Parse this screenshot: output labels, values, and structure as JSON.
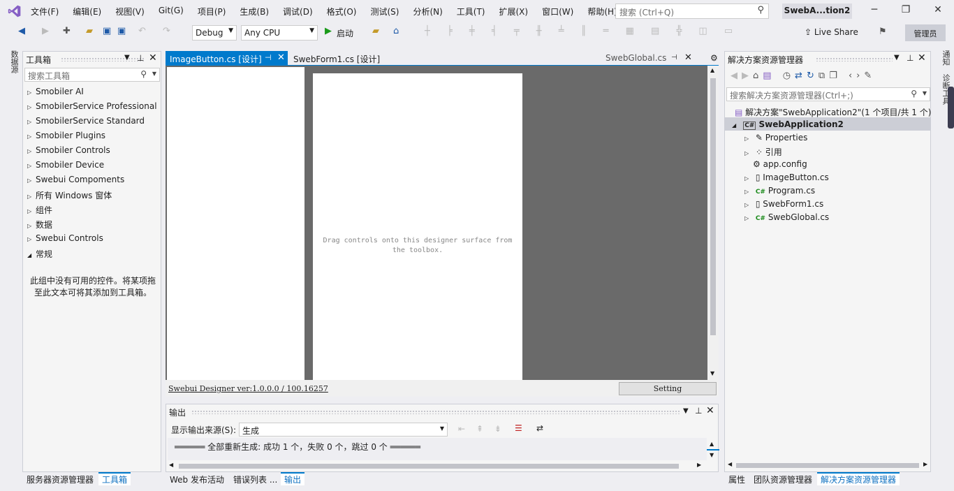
{
  "menu": [
    "文件(F)",
    "编辑(E)",
    "视图(V)",
    "Git(G)",
    "项目(P)",
    "生成(B)",
    "调试(D)",
    "格式(O)",
    "测试(S)",
    "分析(N)",
    "工具(T)",
    "扩展(X)",
    "窗口(W)",
    "帮助(H)"
  ],
  "search": {
    "placeholder": "搜索 (Ctrl+Q)"
  },
  "window": {
    "title": "SwebA...tion2"
  },
  "toolbar": {
    "config": "Debug",
    "platform": "Any CPU",
    "start": "启动",
    "live_share": "Live Share",
    "admin": "管理员"
  },
  "left_strip": "数据源",
  "toolbox": {
    "title": "工具箱",
    "search_placeholder": "搜索工具箱",
    "items": [
      "Smobiler AI",
      "SmobilerService Professional",
      "SmobilerService Standard",
      "Smobiler Plugins",
      "Smobiler Controls",
      "Smobiler Device",
      "Swebui Compoments",
      "所有 Windows 窗体",
      "组件",
      "数据",
      "Swebui Controls",
      "常规"
    ],
    "empty_msg": "此组中没有可用的控件。将某项拖至此文本可将其添加到工具箱。"
  },
  "tabs": {
    "active": "ImageButton.cs [设计]",
    "second": "SwebForm1.cs [设计]",
    "overflow": "SwebGlobal.cs"
  },
  "designer": {
    "drag_text": "Drag controls onto this designer surface from the toolbox.",
    "version": "Swebui Designer ver:1.0.0.0 / 100.16257",
    "setting": "Setting"
  },
  "output": {
    "title": "输出",
    "source_label": "显示输出来源(S):",
    "source_value": "生成",
    "line": "══════ 全部重新生成: 成功 1 个，失败 0 个，跳过 0 个 ══════"
  },
  "solution": {
    "title": "解决方案资源管理器",
    "search_placeholder": "搜索解决方案资源管理器(Ctrl+;)",
    "root": "解决方案\"SwebApplication2\"(1 个项目/共 1 个)",
    "project": "SwebApplication2",
    "items": [
      "Properties",
      "引用",
      "app.config",
      "ImageButton.cs",
      "Program.cs",
      "SwebForm1.cs",
      "SwebGlobal.cs"
    ]
  },
  "right_strip": [
    "通知",
    "诊断工具"
  ],
  "bottom_tabs_left": [
    "服务器资源管理器",
    "工具箱"
  ],
  "bottom_tabs_center": [
    "Web 发布活动",
    "错误列表 ...",
    "输出"
  ],
  "bottom_tabs_right": [
    "属性",
    "团队资源管理器",
    "解决方案资源管理器"
  ]
}
